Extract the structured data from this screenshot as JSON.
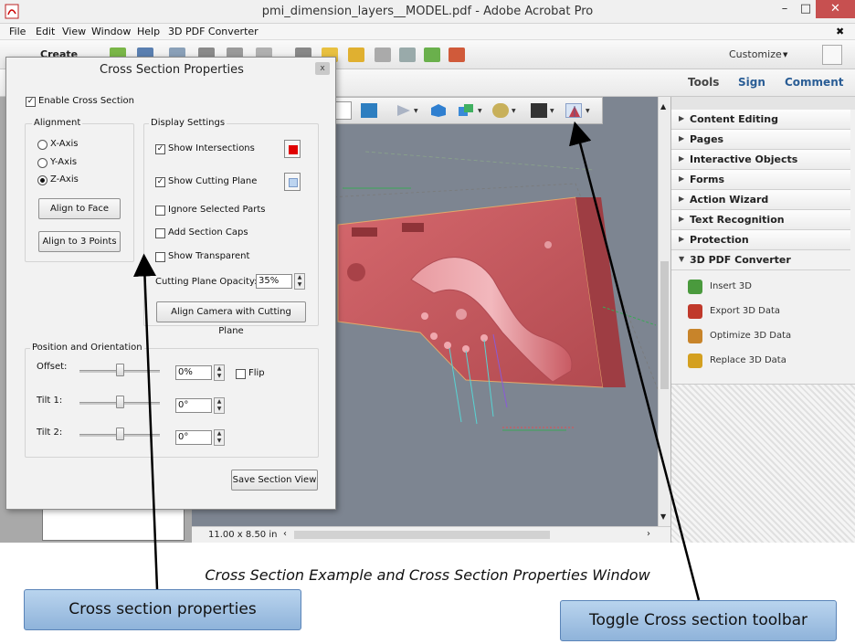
{
  "window": {
    "title": "pmi_dimension_layers__MODEL.pdf - Adobe Acrobat Pro",
    "min": "–",
    "max": "□",
    "close": "✕"
  },
  "menu": {
    "items": [
      "File",
      "Edit",
      "View",
      "Window",
      "Help",
      "3D PDF Converter"
    ],
    "close": "✖"
  },
  "toolbar": {
    "create_label": "Create",
    "customize_label": "Customize"
  },
  "tabs": {
    "tools": "Tools",
    "sign": "Sign",
    "comment": "Comment"
  },
  "status": {
    "page_size": "11.00 x 8.50 in"
  },
  "right_panel": {
    "sections": [
      "Content Editing",
      "Pages",
      "Interactive Objects",
      "Forms",
      "Action Wizard",
      "Text Recognition",
      "Protection"
    ],
    "open_section": "3D PDF Converter",
    "tools": [
      {
        "label": "Insert 3D",
        "icon": "insert-3d-icon",
        "color": "#4a9a3d"
      },
      {
        "label": "Export 3D Data",
        "icon": "export-3d-icon",
        "color": "#c0392b"
      },
      {
        "label": "Optimize 3D Data",
        "icon": "optimize-3d-icon",
        "color": "#c8842a"
      },
      {
        "label": "Replace 3D Data",
        "icon": "replace-3d-icon",
        "color": "#d4a020"
      }
    ]
  },
  "dialog": {
    "title": "Cross Section Properties",
    "close": "x",
    "enable_label": "Enable Cross Section",
    "alignment": {
      "heading": "Alignment",
      "options": [
        "X-Axis",
        "Y-Axis",
        "Z-Axis"
      ],
      "selected": "Z-Axis",
      "align_face": "Align to Face",
      "align_points": "Align to 3 Points"
    },
    "display": {
      "heading": "Display Settings",
      "show_intersections": "Show Intersections",
      "show_cutting_plane": "Show Cutting Plane",
      "ignore_parts": "Ignore Selected Parts",
      "add_caps": "Add Section Caps",
      "show_transparent": "Show Transparent",
      "opacity_label": "Cutting Plane Opacity:",
      "opacity_value": "35%",
      "align_camera": "Align Camera with Cutting Plane",
      "intersection_color": "#e00000",
      "plane_color": "#bcd4f0"
    },
    "position": {
      "heading": "Position and Orientation",
      "offset_label": "Offset:",
      "offset_value": "0%",
      "flip_label": "Flip",
      "tilt1_label": "Tilt 1:",
      "tilt1_value": "0°",
      "tilt2_label": "Tilt 2:",
      "tilt2_value": "0°"
    },
    "save_label": "Save Section View"
  },
  "caption": "Cross Section Example and Cross Section Properties Window",
  "callouts": {
    "left": "Cross section properties",
    "right": "Toggle Cross section toolbar"
  },
  "colors": {
    "model": "#c8565c",
    "viewport_bg": "#7d8591",
    "accent": "#2a5d95"
  }
}
